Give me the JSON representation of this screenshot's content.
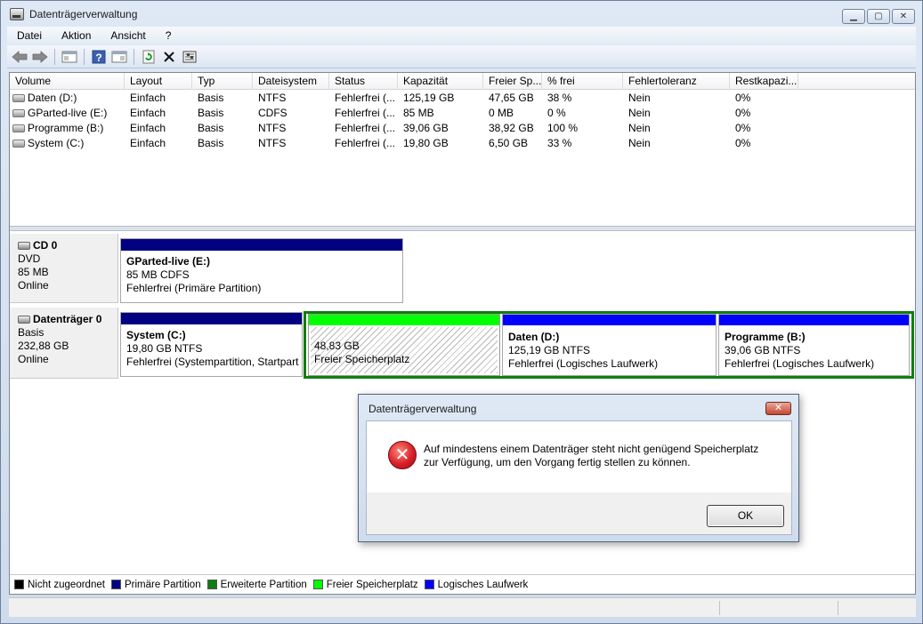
{
  "window": {
    "title": "Datenträgerverwaltung",
    "minimize_symbol": "▁",
    "maximize_symbol": "▢",
    "close_symbol": "✕"
  },
  "menu": {
    "items": [
      "Datei",
      "Aktion",
      "Ansicht",
      "?"
    ]
  },
  "toolbar": {
    "buttons": [
      "back-icon",
      "forward-icon",
      "show-hide-console-tree-icon",
      "help-icon",
      "properties-icon",
      "refresh-icon",
      "delete-icon",
      "settings-icon"
    ]
  },
  "volume_list": {
    "columns": [
      "Volume",
      "Layout",
      "Typ",
      "Dateisystem",
      "Status",
      "Kapazität",
      "Freier Sp...",
      "% frei",
      "Fehlertoleranz",
      "Restkapazi..."
    ],
    "rows": [
      [
        "Daten (D:)",
        "Einfach",
        "Basis",
        "NTFS",
        "Fehlerfrei (...",
        "125,19 GB",
        "47,65 GB",
        "38 %",
        "Nein",
        "0%"
      ],
      [
        "GParted-live (E:)",
        "Einfach",
        "Basis",
        "CDFS",
        "Fehlerfrei (...",
        "85 MB",
        "0 MB",
        "0 %",
        "Nein",
        "0%"
      ],
      [
        "Programme (B:)",
        "Einfach",
        "Basis",
        "NTFS",
        "Fehlerfrei (...",
        "39,06 GB",
        "38,92 GB",
        "100 %",
        "Nein",
        "0%"
      ],
      [
        "System (C:)",
        "Einfach",
        "Basis",
        "NTFS",
        "Fehlerfrei (...",
        "19,80 GB",
        "6,50 GB",
        "33 %",
        "Nein",
        "0%"
      ]
    ]
  },
  "disks": {
    "cd0": {
      "name": "CD 0",
      "type": "DVD",
      "size": "85 MB",
      "status": "Online",
      "partition": {
        "title": "GParted-live  (E:)",
        "detail": "85 MB CDFS",
        "status": "Fehlerfrei (Primäre Partition)"
      }
    },
    "disk0": {
      "name": "Datenträger 0",
      "type": "Basis",
      "size": "232,88 GB",
      "status": "Online",
      "system": {
        "title": "System  (C:)",
        "detail": "19,80 GB NTFS",
        "status": "Fehlerfrei (Systempartition, Startpart"
      },
      "free": {
        "detail": "48,83 GB",
        "status": "Freier Speicherplatz"
      },
      "daten": {
        "title": "Daten  (D:)",
        "detail": "125,19 GB NTFS",
        "status": "Fehlerfrei (Logisches Laufwerk)"
      },
      "programme": {
        "title": "Programme  (B:)",
        "detail": "39,06 GB NTFS",
        "status": "Fehlerfrei (Logisches Laufwerk)"
      }
    }
  },
  "legend": {
    "items": [
      {
        "label": "Nicht zugeordnet",
        "color": "#000000"
      },
      {
        "label": "Primäre Partition",
        "color": "#000080"
      },
      {
        "label": "Erweiterte Partition",
        "color": "#107d10"
      },
      {
        "label": "Freier Speicherplatz",
        "color": "#00ff00"
      },
      {
        "label": "Logisches Laufwerk",
        "color": "#0000ff"
      }
    ]
  },
  "dialog": {
    "title": "Datenträgerverwaltung",
    "close_symbol": "✕",
    "message_line1": "Auf mindestens einem Datenträger steht nicht genügend Speicherplatz",
    "message_line2": "zur Verfügung, um den Vorgang fertig stellen zu können.",
    "ok_label": "OK",
    "icon": "error-icon"
  },
  "colors": {
    "primary_partition": "#000080",
    "logical_drive": "#0000ff",
    "free_space": "#00ff00",
    "extended_partition": "#107d10"
  }
}
